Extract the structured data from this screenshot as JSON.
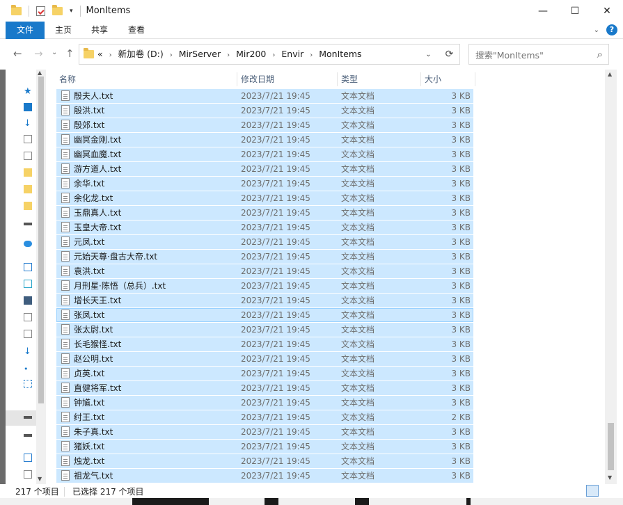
{
  "window": {
    "title": "MonItems",
    "minimize": "—",
    "maximize": "☐",
    "close": "✕"
  },
  "ribbon": {
    "tabs": [
      "文件",
      "主页",
      "共享",
      "查看"
    ]
  },
  "nav": {
    "back": "←",
    "forward": "→",
    "recent": "⌄",
    "up": "↑"
  },
  "address": {
    "overflow": "«",
    "crumbs": [
      "新加卷 (D:)",
      "MirServer",
      "Mir200",
      "Envir",
      "MonItems"
    ]
  },
  "search": {
    "placeholder": "搜索\"MonItems\""
  },
  "columns": {
    "name": "名称",
    "date": "修改日期",
    "type": "类型",
    "size": "大小"
  },
  "files": [
    {
      "name": "殷夫人.txt",
      "date": "2023/7/21 19:45",
      "type": "文本文档",
      "size": "3 KB"
    },
    {
      "name": "殷洪.txt",
      "date": "2023/7/21 19:45",
      "type": "文本文档",
      "size": "3 KB"
    },
    {
      "name": "殷郊.txt",
      "date": "2023/7/21 19:45",
      "type": "文本文档",
      "size": "3 KB"
    },
    {
      "name": "幽冥金刚.txt",
      "date": "2023/7/21 19:45",
      "type": "文本文档",
      "size": "3 KB"
    },
    {
      "name": "幽冥血魔.txt",
      "date": "2023/7/21 19:45",
      "type": "文本文档",
      "size": "3 KB"
    },
    {
      "name": "游方道人.txt",
      "date": "2023/7/21 19:45",
      "type": "文本文档",
      "size": "3 KB"
    },
    {
      "name": "余华.txt",
      "date": "2023/7/21 19:45",
      "type": "文本文档",
      "size": "3 KB"
    },
    {
      "name": "余化龙.txt",
      "date": "2023/7/21 19:45",
      "type": "文本文档",
      "size": "3 KB"
    },
    {
      "name": "玉鼎真人.txt",
      "date": "2023/7/21 19:45",
      "type": "文本文档",
      "size": "3 KB"
    },
    {
      "name": "玉皇大帝.txt",
      "date": "2023/7/21 19:45",
      "type": "文本文档",
      "size": "3 KB"
    },
    {
      "name": "元凤.txt",
      "date": "2023/7/21 19:45",
      "type": "文本文档",
      "size": "3 KB"
    },
    {
      "name": "元始天尊·盘古大帝.txt",
      "date": "2023/7/21 19:45",
      "type": "文本文档",
      "size": "3 KB"
    },
    {
      "name": "袁洪.txt",
      "date": "2023/7/21 19:45",
      "type": "文本文档",
      "size": "3 KB"
    },
    {
      "name": "月刑星·陈悟（总兵）.txt",
      "date": "2023/7/21 19:45",
      "type": "文本文档",
      "size": "3 KB"
    },
    {
      "name": "增长天王.txt",
      "date": "2023/7/21 19:45",
      "type": "文本文档",
      "size": "3 KB"
    },
    {
      "name": "张凤.txt",
      "date": "2023/7/21 19:45",
      "type": "文本文档",
      "size": "3 KB"
    },
    {
      "name": "张太尉.txt",
      "date": "2023/7/21 19:45",
      "type": "文本文档",
      "size": "3 KB"
    },
    {
      "name": "长毛猴怪.txt",
      "date": "2023/7/21 19:45",
      "type": "文本文档",
      "size": "3 KB"
    },
    {
      "name": "赵公明.txt",
      "date": "2023/7/21 19:45",
      "type": "文本文档",
      "size": "3 KB"
    },
    {
      "name": "贞英.txt",
      "date": "2023/7/21 19:45",
      "type": "文本文档",
      "size": "3 KB"
    },
    {
      "name": "直健将军.txt",
      "date": "2023/7/21 19:45",
      "type": "文本文档",
      "size": "3 KB"
    },
    {
      "name": "钟馗.txt",
      "date": "2023/7/21 19:45",
      "type": "文本文档",
      "size": "3 KB"
    },
    {
      "name": "纣王.txt",
      "date": "2023/7/21 19:45",
      "type": "文本文档",
      "size": "2 KB"
    },
    {
      "name": "朱子真.txt",
      "date": "2023/7/21 19:45",
      "type": "文本文档",
      "size": "3 KB"
    },
    {
      "name": "猪妖.txt",
      "date": "2023/7/21 19:45",
      "type": "文本文档",
      "size": "3 KB"
    },
    {
      "name": "烛龙.txt",
      "date": "2023/7/21 19:45",
      "type": "文本文档",
      "size": "3 KB"
    },
    {
      "name": "祖龙气.txt",
      "date": "2023/7/21 19:45",
      "type": "文本文档",
      "size": "3 KB"
    }
  ],
  "status": {
    "count": "217 个项目",
    "selected": "已选择 217 个项目"
  },
  "colors": {
    "accent": "#1979ca",
    "selection": "#cce8ff",
    "selection_border": "#99d1ff"
  }
}
